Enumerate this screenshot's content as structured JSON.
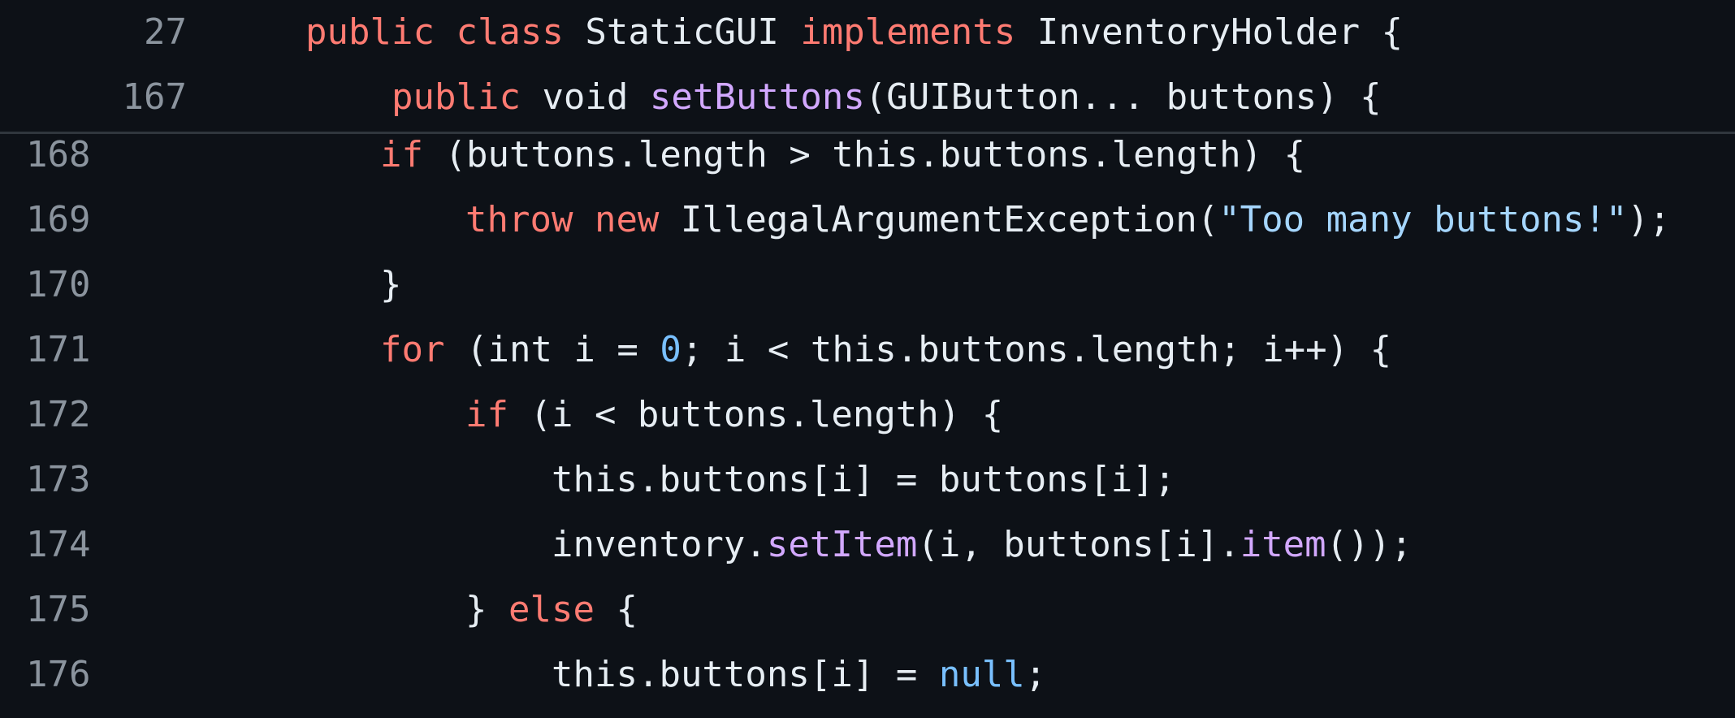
{
  "sticky": [
    {
      "line": "27",
      "indent": 376,
      "tokens": [
        {
          "t": "public",
          "c": "k"
        },
        {
          "t": " ",
          "c": "p"
        },
        {
          "t": "class",
          "c": "k"
        },
        {
          "t": " StaticGUI ",
          "c": "p"
        },
        {
          "t": "implements",
          "c": "k"
        },
        {
          "t": " InventoryHolder {",
          "c": "p"
        }
      ]
    },
    {
      "line": "167",
      "indent": 482,
      "tokens": [
        {
          "t": "public",
          "c": "k"
        },
        {
          "t": " void ",
          "c": "p"
        },
        {
          "t": "setButtons",
          "c": "f"
        },
        {
          "t": "(GUIButton... buttons) {",
          "c": "p"
        }
      ]
    }
  ],
  "lines": [
    {
      "line": "168",
      "indent": 468,
      "tokens": [
        {
          "t": "if",
          "c": "k"
        },
        {
          "t": " (buttons.length > this.buttons.length) {",
          "c": "p"
        }
      ]
    },
    {
      "line": "169",
      "indent": 573,
      "tokens": [
        {
          "t": "throw",
          "c": "k"
        },
        {
          "t": " ",
          "c": "p"
        },
        {
          "t": "new",
          "c": "k"
        },
        {
          "t": " IllegalArgumentException(",
          "c": "p"
        },
        {
          "t": "\"Too many buttons!\"",
          "c": "s"
        },
        {
          "t": ");",
          "c": "p"
        }
      ]
    },
    {
      "line": "170",
      "indent": 468,
      "tokens": [
        {
          "t": "}",
          "c": "p"
        }
      ]
    },
    {
      "line": "171",
      "indent": 468,
      "tokens": [
        {
          "t": "for",
          "c": "k"
        },
        {
          "t": " (int i = ",
          "c": "p"
        },
        {
          "t": "0",
          "c": "c"
        },
        {
          "t": "; i < this.buttons.length; i++) {",
          "c": "p"
        }
      ]
    },
    {
      "line": "172",
      "indent": 573,
      "tokens": [
        {
          "t": "if",
          "c": "k"
        },
        {
          "t": " (i < buttons.length) {",
          "c": "p"
        }
      ]
    },
    {
      "line": "173",
      "indent": 679,
      "tokens": [
        {
          "t": "this.buttons[i] = buttons[i];",
          "c": "p"
        }
      ]
    },
    {
      "line": "174",
      "indent": 679,
      "tokens": [
        {
          "t": "inventory.",
          "c": "p"
        },
        {
          "t": "setItem",
          "c": "f"
        },
        {
          "t": "(i, buttons[i].",
          "c": "p"
        },
        {
          "t": "item",
          "c": "f"
        },
        {
          "t": "());",
          "c": "p"
        }
      ]
    },
    {
      "line": "175",
      "indent": 573,
      "tokens": [
        {
          "t": "} ",
          "c": "p"
        },
        {
          "t": "else",
          "c": "k"
        },
        {
          "t": " {",
          "c": "p"
        }
      ]
    },
    {
      "line": "176",
      "indent": 679,
      "tokens": [
        {
          "t": "this.buttons[i] = ",
          "c": "p"
        },
        {
          "t": "null",
          "c": "c"
        },
        {
          "t": ";",
          "c": "p"
        }
      ]
    }
  ]
}
